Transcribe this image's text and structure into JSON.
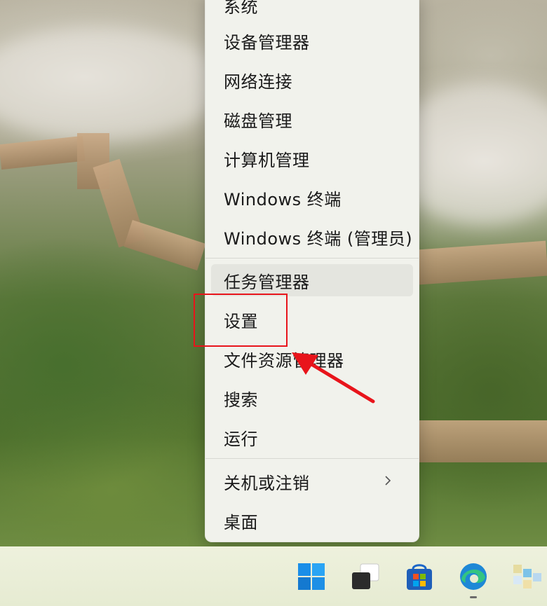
{
  "menu": {
    "items": [
      {
        "label": "系统"
      },
      {
        "label": "设备管理器"
      },
      {
        "label": "网络连接"
      },
      {
        "label": "磁盘管理"
      },
      {
        "label": "计算机管理"
      },
      {
        "label": "Windows 终端"
      },
      {
        "label": "Windows 终端 (管理员)"
      },
      {
        "label": "任务管理器"
      },
      {
        "label": "设置"
      },
      {
        "label": "文件资源管理器"
      },
      {
        "label": "搜索"
      },
      {
        "label": "运行"
      },
      {
        "label": "关机或注销"
      },
      {
        "label": "桌面"
      }
    ]
  },
  "taskbar": {
    "icons": [
      "windows-start-icon",
      "task-view-icon",
      "microsoft-store-icon",
      "edge-browser-icon",
      "widget-icon"
    ]
  },
  "annotation": {
    "highlight_color": "#e8141b",
    "arrow_color": "#e8141b"
  }
}
